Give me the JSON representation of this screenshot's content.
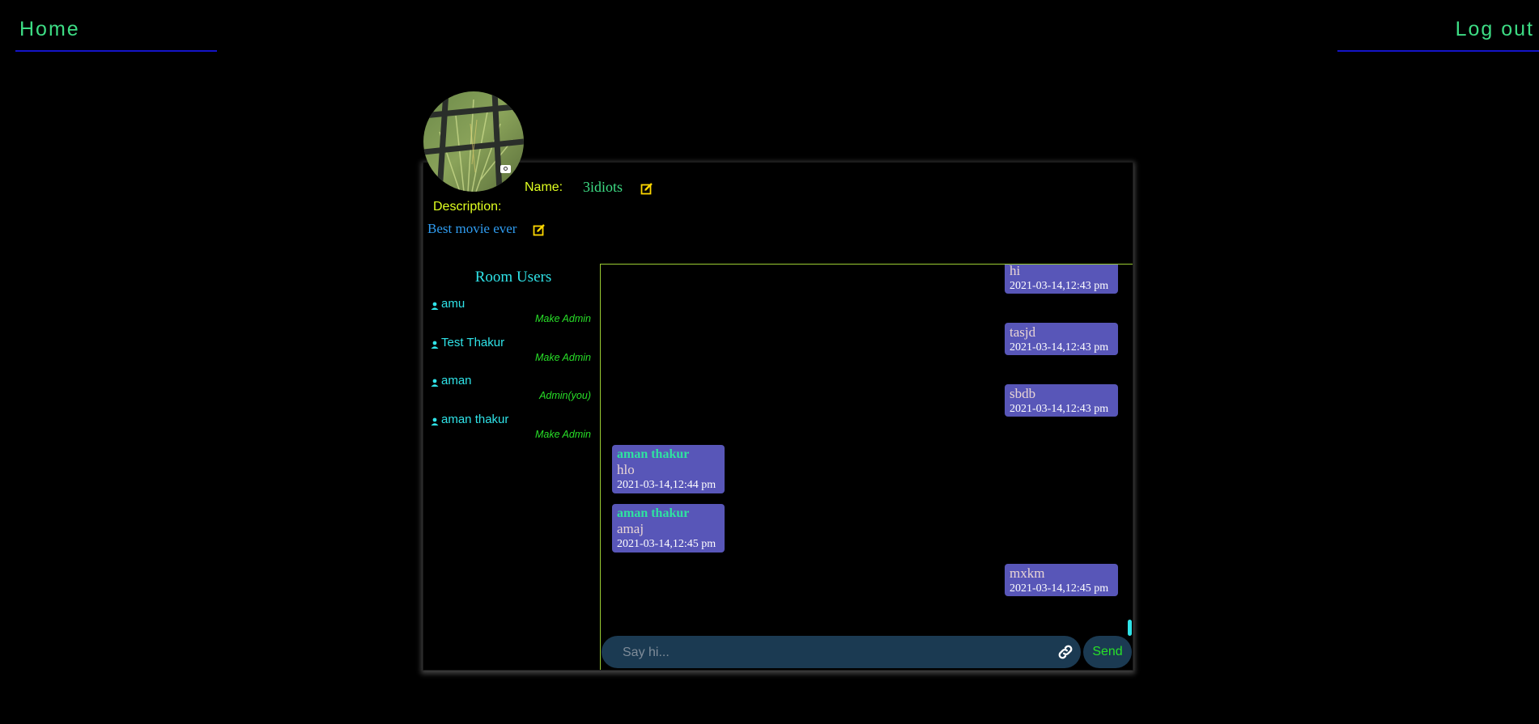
{
  "nav": {
    "home_label": "Home",
    "logout_label": "Log out",
    "accent_color": "#3ddc84",
    "underline_color": "#1414c8"
  },
  "room": {
    "name_label": "Name:",
    "name": "3idiots",
    "description_label": "Description:",
    "description": "Best movie ever"
  },
  "users": {
    "title": "Room Users",
    "items": [
      {
        "name": "amu",
        "action": "Make Admin"
      },
      {
        "name": "Test Thakur",
        "action": "Make Admin"
      },
      {
        "name": "aman",
        "action": "Admin(you)"
      },
      {
        "name": "aman thakur",
        "action": "Make Admin"
      }
    ]
  },
  "messages": [
    {
      "sender": "",
      "text": "hi",
      "time": "2021-03-14,12:43 pm",
      "own": true
    },
    {
      "sender": "",
      "text": "tasjd",
      "time": "2021-03-14,12:43 pm",
      "own": true
    },
    {
      "sender": "",
      "text": "sbdb",
      "time": "2021-03-14,12:43 pm",
      "own": true
    },
    {
      "sender": "aman thakur",
      "text": "hlo",
      "time": "2021-03-14,12:44 pm",
      "own": false
    },
    {
      "sender": "aman thakur",
      "text": "amaj",
      "time": "2021-03-14,12:45 pm",
      "own": false
    },
    {
      "sender": "",
      "text": "mxkm",
      "time": "2021-03-14,12:45 pm",
      "own": true
    }
  ],
  "composer": {
    "placeholder": "Say hi...",
    "send_label": "Send"
  },
  "colors": {
    "bubble": "#5856b8",
    "chat_border": "#9acd32",
    "user_text": "#2fe3e8",
    "action_text": "#28e028",
    "label_text": "#e0ff20",
    "edit_icon": "#ffd800"
  },
  "icons": {
    "edit": "edit-icon",
    "camera": "camera-icon",
    "user": "user-icon",
    "link": "link-icon"
  }
}
